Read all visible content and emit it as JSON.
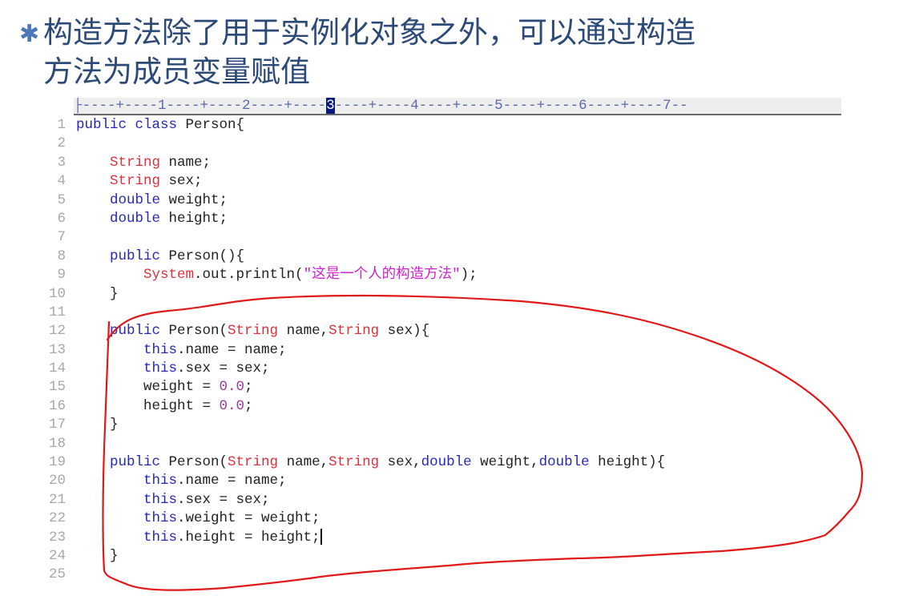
{
  "slide": {
    "bullet_icon": "asterisk-bullet",
    "title_lines": [
      "构造方法除了用于实例化对象之外，可以通过构造",
      "方法为成员变量赋值"
    ]
  },
  "editor": {
    "ruler": {
      "before_cursor": "├----+----1----+----2----+----",
      "cursor_col": "3",
      "after_cursor": "----+----4----+----5----+----6----+----7--"
    },
    "lines": [
      {
        "n": "1",
        "tokens": [
          {
            "t": "kw",
            "v": "public class "
          },
          {
            "t": "tx",
            "v": "Person{"
          }
        ]
      },
      {
        "n": "2",
        "tokens": []
      },
      {
        "n": "3",
        "tokens": [
          {
            "t": "tx",
            "v": "    "
          },
          {
            "t": "ty",
            "v": "String"
          },
          {
            "t": "tx",
            "v": " name;"
          }
        ]
      },
      {
        "n": "4",
        "tokens": [
          {
            "t": "tx",
            "v": "    "
          },
          {
            "t": "ty",
            "v": "String"
          },
          {
            "t": "tx",
            "v": " sex;"
          }
        ]
      },
      {
        "n": "5",
        "tokens": [
          {
            "t": "tx",
            "v": "    "
          },
          {
            "t": "kw",
            "v": "double"
          },
          {
            "t": "tx",
            "v": " weight;"
          }
        ]
      },
      {
        "n": "6",
        "tokens": [
          {
            "t": "tx",
            "v": "    "
          },
          {
            "t": "kw",
            "v": "double"
          },
          {
            "t": "tx",
            "v": " height;"
          }
        ]
      },
      {
        "n": "7",
        "tokens": []
      },
      {
        "n": "8",
        "tokens": [
          {
            "t": "tx",
            "v": "    "
          },
          {
            "t": "kw",
            "v": "public"
          },
          {
            "t": "tx",
            "v": " Person(){"
          }
        ]
      },
      {
        "n": "9",
        "tokens": [
          {
            "t": "tx",
            "v": "        "
          },
          {
            "t": "ty",
            "v": "System"
          },
          {
            "t": "tx",
            "v": ".out.println("
          },
          {
            "t": "str",
            "v": "\"这是一个人的构造方法\""
          },
          {
            "t": "tx",
            "v": ");"
          }
        ]
      },
      {
        "n": "10",
        "tokens": [
          {
            "t": "tx",
            "v": "    }"
          }
        ]
      },
      {
        "n": "11",
        "tokens": []
      },
      {
        "n": "12",
        "tokens": [
          {
            "t": "tx",
            "v": "    "
          },
          {
            "t": "kw",
            "v": "public"
          },
          {
            "t": "tx",
            "v": " Person("
          },
          {
            "t": "ty",
            "v": "String"
          },
          {
            "t": "tx",
            "v": " name,"
          },
          {
            "t": "ty",
            "v": "String"
          },
          {
            "t": "tx",
            "v": " sex){"
          }
        ]
      },
      {
        "n": "13",
        "tokens": [
          {
            "t": "tx",
            "v": "        "
          },
          {
            "t": "kw",
            "v": "this"
          },
          {
            "t": "tx",
            "v": ".name = name;"
          }
        ]
      },
      {
        "n": "14",
        "tokens": [
          {
            "t": "tx",
            "v": "        "
          },
          {
            "t": "kw",
            "v": "this"
          },
          {
            "t": "tx",
            "v": ".sex = sex;"
          }
        ]
      },
      {
        "n": "15",
        "tokens": [
          {
            "t": "tx",
            "v": "        weight = "
          },
          {
            "t": "num",
            "v": "0.0"
          },
          {
            "t": "tx",
            "v": ";"
          }
        ]
      },
      {
        "n": "16",
        "tokens": [
          {
            "t": "tx",
            "v": "        height = "
          },
          {
            "t": "num",
            "v": "0.0"
          },
          {
            "t": "tx",
            "v": ";"
          }
        ]
      },
      {
        "n": "17",
        "tokens": [
          {
            "t": "tx",
            "v": "    }"
          }
        ]
      },
      {
        "n": "18",
        "tokens": []
      },
      {
        "n": "19",
        "tokens": [
          {
            "t": "tx",
            "v": "    "
          },
          {
            "t": "kw",
            "v": "public"
          },
          {
            "t": "tx",
            "v": " Person("
          },
          {
            "t": "ty",
            "v": "String"
          },
          {
            "t": "tx",
            "v": " name,"
          },
          {
            "t": "ty",
            "v": "String"
          },
          {
            "t": "tx",
            "v": " sex,"
          },
          {
            "t": "kw",
            "v": "double"
          },
          {
            "t": "tx",
            "v": " weight,"
          },
          {
            "t": "kw",
            "v": "double"
          },
          {
            "t": "tx",
            "v": " height){"
          }
        ]
      },
      {
        "n": "20",
        "tokens": [
          {
            "t": "tx",
            "v": "        "
          },
          {
            "t": "kw",
            "v": "this"
          },
          {
            "t": "tx",
            "v": ".name = name;"
          }
        ]
      },
      {
        "n": "21",
        "tokens": [
          {
            "t": "tx",
            "v": "        "
          },
          {
            "t": "kw",
            "v": "this"
          },
          {
            "t": "tx",
            "v": ".sex = sex;"
          }
        ]
      },
      {
        "n": "22",
        "tokens": [
          {
            "t": "tx",
            "v": "        "
          },
          {
            "t": "kw",
            "v": "this"
          },
          {
            "t": "tx",
            "v": ".weight = weight;"
          }
        ]
      },
      {
        "n": "23",
        "tokens": [
          {
            "t": "tx",
            "v": "        "
          },
          {
            "t": "kw",
            "v": "this"
          },
          {
            "t": "tx",
            "v": ".height = height;"
          }
        ],
        "caret": true
      },
      {
        "n": "24",
        "tokens": [
          {
            "t": "tx",
            "v": "    }"
          }
        ]
      },
      {
        "n": "25",
        "tokens": []
      }
    ],
    "colors": {
      "keyword": "#2828b8",
      "type": "#e0303a",
      "string": "#d020d0",
      "number": "#9a3a9a",
      "annotation": "#e01818"
    }
  }
}
